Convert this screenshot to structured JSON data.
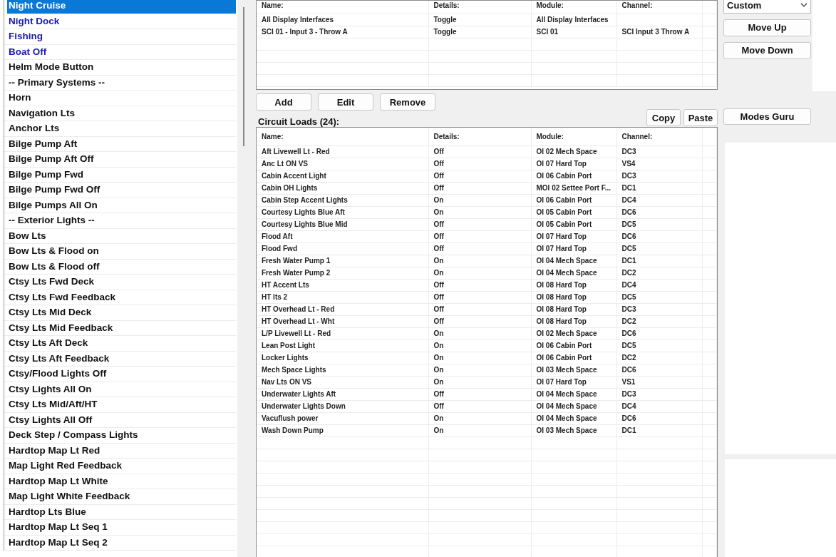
{
  "modes_list": {
    "items": [
      {
        "label": "Night Cruise",
        "kind": "mode",
        "selected": true
      },
      {
        "label": "Night Dock",
        "kind": "mode",
        "selected": false
      },
      {
        "label": "Fishing",
        "kind": "mode",
        "selected": false
      },
      {
        "label": "Boat Off",
        "kind": "mode",
        "selected": false
      },
      {
        "label": "Helm Mode Button",
        "kind": "item",
        "selected": false
      },
      {
        "label": "-- Primary Systems --",
        "kind": "item",
        "selected": false
      },
      {
        "label": "Horn",
        "kind": "item",
        "selected": false
      },
      {
        "label": "Navigation Lts",
        "kind": "item",
        "selected": false
      },
      {
        "label": "Anchor Lts",
        "kind": "item",
        "selected": false
      },
      {
        "label": "Bilge Pump Aft",
        "kind": "item",
        "selected": false
      },
      {
        "label": "Bilge Pump Aft Off",
        "kind": "item",
        "selected": false
      },
      {
        "label": "Bilge Pump Fwd",
        "kind": "item",
        "selected": false
      },
      {
        "label": "Bilge Pump Fwd Off",
        "kind": "item",
        "selected": false
      },
      {
        "label": "Bilge Pumps All On",
        "kind": "item",
        "selected": false
      },
      {
        "label": "-- Exterior Lights --",
        "kind": "item",
        "selected": false
      },
      {
        "label": "Bow Lts",
        "kind": "item",
        "selected": false
      },
      {
        "label": "Bow Lts & Flood on",
        "kind": "item",
        "selected": false
      },
      {
        "label": "Bow Lts & Flood off",
        "kind": "item",
        "selected": false
      },
      {
        "label": "Ctsy Lts Fwd Deck",
        "kind": "item",
        "selected": false
      },
      {
        "label": "Ctsy Lts Fwd Feedback",
        "kind": "item",
        "selected": false
      },
      {
        "label": "Ctsy Lts Mid Deck",
        "kind": "item",
        "selected": false
      },
      {
        "label": "Ctsy Lts Mid Feedback",
        "kind": "item",
        "selected": false
      },
      {
        "label": "Ctsy Lts Aft Deck",
        "kind": "item",
        "selected": false
      },
      {
        "label": "Ctsy Lts Aft Feedback",
        "kind": "item",
        "selected": false
      },
      {
        "label": "Ctsy/Flood Lights Off",
        "kind": "item",
        "selected": false
      },
      {
        "label": "Ctsy Lights All On",
        "kind": "item",
        "selected": false
      },
      {
        "label": "Ctsy Lts Mid/Aft/HT",
        "kind": "item",
        "selected": false
      },
      {
        "label": "Ctsy Lights All Off",
        "kind": "item",
        "selected": false
      },
      {
        "label": "Deck Step / Compass Lights",
        "kind": "item",
        "selected": false
      },
      {
        "label": "Hardtop Map Lt Red",
        "kind": "item",
        "selected": false
      },
      {
        "label": "Map Light Red Feedback",
        "kind": "item",
        "selected": false
      },
      {
        "label": "Hardtop Map Lt White",
        "kind": "item",
        "selected": false
      },
      {
        "label": "Map Light White Feedback",
        "kind": "item",
        "selected": false
      },
      {
        "label": "Hardtop Lts Blue",
        "kind": "item",
        "selected": false
      },
      {
        "label": "Hardtop Map Lt Seq 1",
        "kind": "item",
        "selected": false
      },
      {
        "label": "Hardtop Map Lt Seq 2",
        "kind": "item",
        "selected": false
      }
    ]
  },
  "inputs_table": {
    "columns": [
      "Name:",
      "Details:",
      "Module:",
      "Channel:"
    ],
    "rows": [
      [
        "All Display Interfaces",
        "Toggle",
        "All Display Interfaces",
        ""
      ],
      [
        "SCI 01 - Input 3 - Throw A",
        "Toggle",
        "SCI 01",
        "SCI Input 3 Throw A"
      ]
    ]
  },
  "input_buttons": [
    "Add",
    "Edit",
    "Remove"
  ],
  "circuit_loads": {
    "title": "Circuit Loads (24):",
    "buttons": [
      "Copy",
      "Paste"
    ],
    "columns": [
      "Name:",
      "Details:",
      "Module:",
      "Channel:"
    ],
    "rows": [
      [
        "Aft Livewell Lt - Red",
        "Off",
        "OI 02 Mech Space",
        "DC3"
      ],
      [
        "Anc Lt ON VS",
        "Off",
        "OI 07 Hard Top",
        "VS4"
      ],
      [
        "Cabin Accent Light",
        "Off",
        "OI 06 Cabin Port",
        "DC3"
      ],
      [
        "Cabin OH Lights",
        "Off",
        "MOI 02 Settee Port F...",
        "DC1"
      ],
      [
        "Cabin Step Accent Lights",
        "On",
        "OI 06 Cabin Port",
        "DC4"
      ],
      [
        "Courtesy Lights Blue Aft",
        "On",
        "OI 05 Cabin Port",
        "DC6"
      ],
      [
        "Courtesy Lights Blue Mid",
        "Off",
        "OI 05 Cabin Port",
        "DC5"
      ],
      [
        "Flood Aft",
        "Off",
        "OI 07 Hard Top",
        "DC6"
      ],
      [
        "Flood Fwd",
        "Off",
        "OI 07 Hard Top",
        "DC5"
      ],
      [
        "Fresh Water Pump 1",
        "On",
        "OI 04 Mech Space",
        "DC1"
      ],
      [
        "Fresh Water Pump 2",
        "On",
        "OI 04 Mech Space",
        "DC2"
      ],
      [
        "HT Accent Lts",
        "Off",
        "OI 08 Hard Top",
        "DC4"
      ],
      [
        "HT lts 2",
        "Off",
        "OI 08 Hard Top",
        "DC5"
      ],
      [
        "HT Overhead Lt - Red",
        "Off",
        "OI 08 Hard Top",
        "DC3"
      ],
      [
        "HT Overhead Lt - Wht",
        "Off",
        "OI 08 Hard Top",
        "DC2"
      ],
      [
        "L/P Livewell Lt - Red",
        "On",
        "OI 02 Mech Space",
        "DC6"
      ],
      [
        "Lean Post Light",
        "On",
        "OI 06 Cabin Port",
        "DC5"
      ],
      [
        "Locker Lights",
        "On",
        "OI 06 Cabin Port",
        "DC2"
      ],
      [
        "Mech Space Lights",
        "On",
        "OI 03 Mech Space",
        "DC6"
      ],
      [
        "Nav Lts ON VS",
        "On",
        "OI 07 Hard Top",
        "VS1"
      ],
      [
        "Underwater Lights Aft",
        "Off",
        "OI 04 Mech Space",
        "DC3"
      ],
      [
        "Underwater Lights Down",
        "Off",
        "OI 04 Mech Space",
        "DC4"
      ],
      [
        "Vacuflush power",
        "On",
        "OI 04 Mech Space",
        "DC6"
      ],
      [
        "Wash Down Pump",
        "On",
        "OI 03 Mech Space",
        "DC1"
      ]
    ]
  },
  "side_panel": {
    "dropdown": {
      "value": "Custom"
    },
    "buttons": [
      "Move Up",
      "Move Down"
    ],
    "guru_button": "Modes Guru"
  }
}
